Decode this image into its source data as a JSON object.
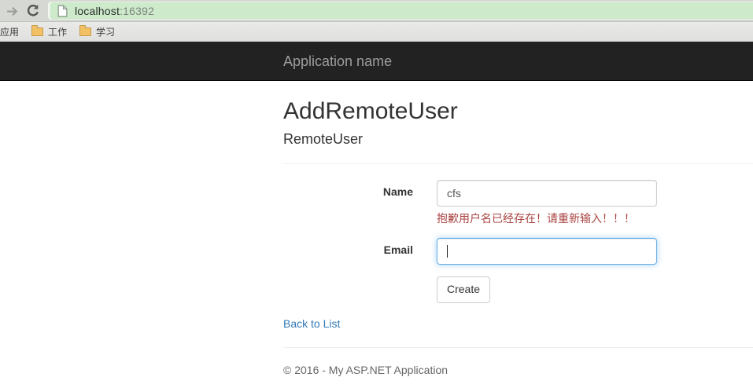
{
  "browser": {
    "url": {
      "host": "localhost",
      "port": ":16392"
    },
    "bookmarks": {
      "apps": "应用",
      "work": "工作",
      "study": "学习"
    }
  },
  "navbar": {
    "brand": "Application name"
  },
  "page": {
    "title": "AddRemoteUser",
    "subtitle": "RemoteUser",
    "form": {
      "fields": [
        {
          "label": "Name",
          "value": "cfs",
          "error": "抱歉用户名已经存在！请重新输入！！！"
        },
        {
          "label": "Email",
          "value": ""
        }
      ],
      "submit_label": "Create"
    },
    "back_link": "Back to List",
    "footer": "© 2016 - My ASP.NET Application"
  },
  "colors": {
    "error_text": "#a94442",
    "link": "#337ab7",
    "focus_border": "#66afe9",
    "navbar_bg": "#222222",
    "navbar_text": "#9d9d9d",
    "omnibox_bg": "#cdeacb",
    "toolbar_bg": "#d6d8d3"
  }
}
